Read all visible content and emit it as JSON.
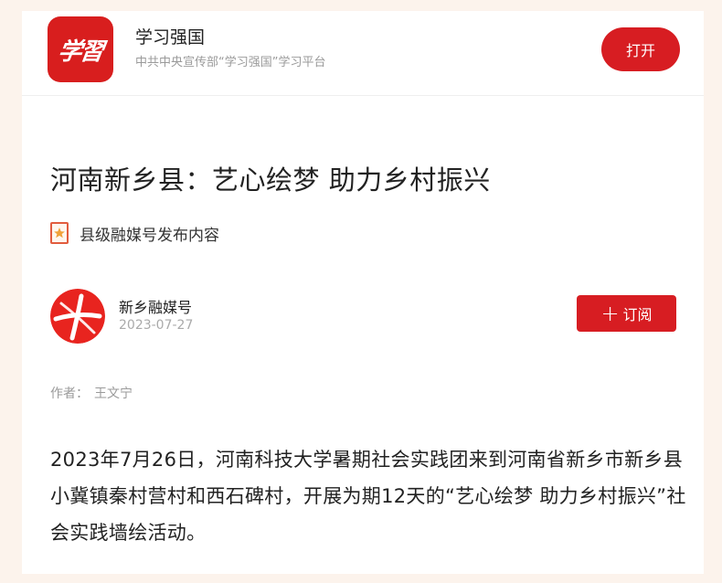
{
  "app_banner": {
    "logo_text": "学習",
    "app_name": "学习强国",
    "app_subtitle": "中共中央宣传部“学习强国”学习平台",
    "open_label": "打开",
    "brand_color": "#d71d22"
  },
  "article": {
    "title": "河南新乡县：艺心绘梦 助力乡村振兴",
    "tag_icon": "star-badge-icon",
    "tag_text": "县级融媒号发布内容",
    "source": {
      "name": "新乡融媒号",
      "date": "2023-07-27",
      "subscribe_label": "订阅",
      "subscribe_icon": "plus-icon"
    },
    "author_label": "作者：",
    "author_name": "王文宁",
    "body": "2023年7月26日，河南科技大学暑期社会实践团来到河南省新乡市新乡县小冀镇秦村营村和西石碑村，开展为期12天的“艺心绘梦 助力乡村振兴”社会实践墙绘活动。"
  }
}
